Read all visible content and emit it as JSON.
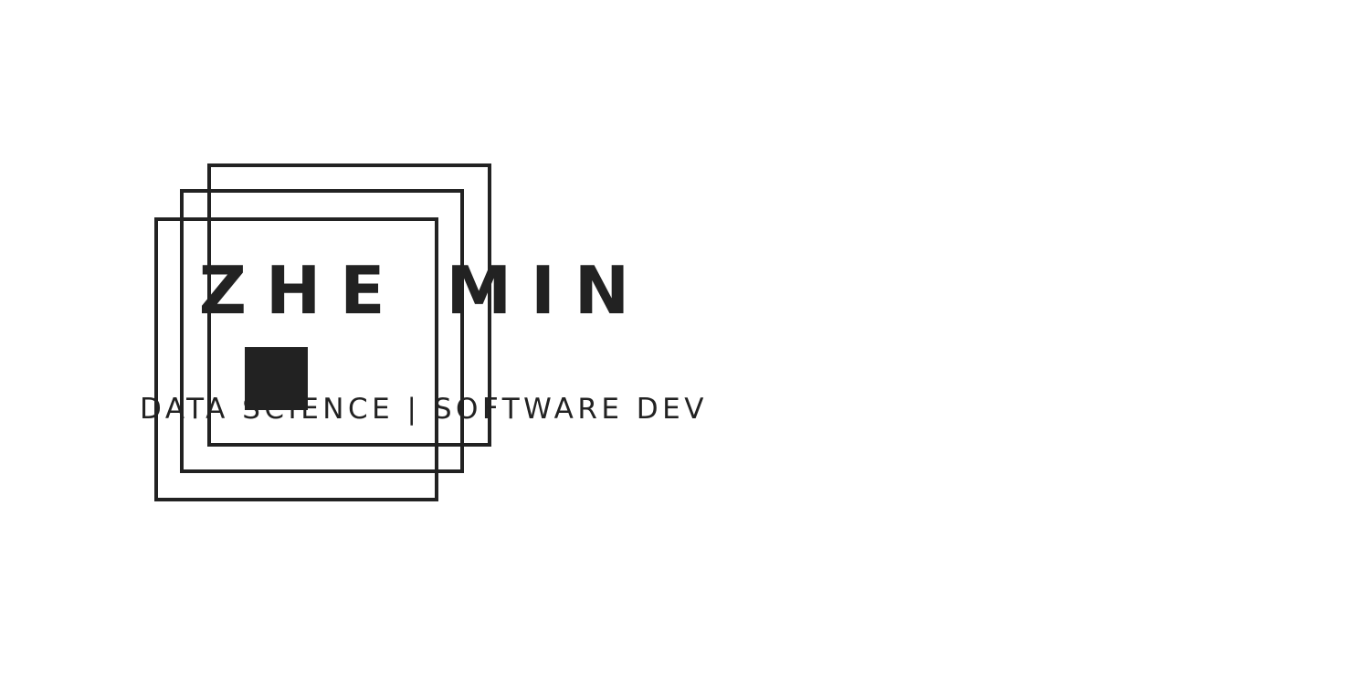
{
  "logo": {
    "name": "ZHE MIN",
    "tagline": "DATA SCIENCE | SOFTWARE DEV",
    "mark": "nested-squares-icon",
    "color": "#222222",
    "background": "#ffffff"
  }
}
